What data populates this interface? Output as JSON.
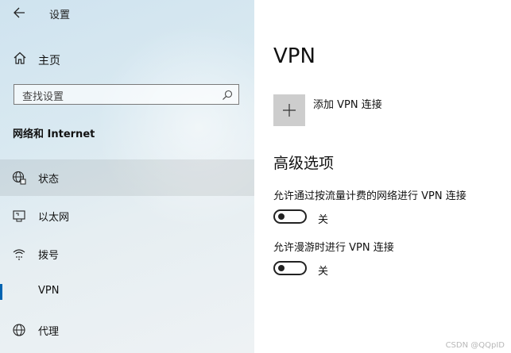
{
  "header": {
    "title": "设置"
  },
  "sidebar": {
    "home_label": "主页",
    "search_placeholder": "查找设置",
    "section_title": "网络和 Internet",
    "items": [
      {
        "label": "状态",
        "icon": "globe-status-icon",
        "selected": true
      },
      {
        "label": "以太网",
        "icon": "ethernet-icon",
        "selected": false
      },
      {
        "label": "拨号",
        "icon": "dialup-icon",
        "selected": false
      },
      {
        "label": "VPN",
        "icon": "vpn-icon",
        "selected": false,
        "active_indicator": true
      },
      {
        "label": "代理",
        "icon": "globe-icon",
        "selected": false
      }
    ]
  },
  "main": {
    "title": "VPN",
    "add_label": "添加 VPN 连接",
    "advanced_title": "高级选项",
    "options": [
      {
        "label": "允许通过按流量计费的网络进行 VPN 连接",
        "state": "关"
      },
      {
        "label": "允许漫游时进行 VPN 连接",
        "state": "关"
      }
    ]
  },
  "watermark": "CSDN @QQpID",
  "colors": {
    "accent": "#0063b1",
    "tile": "#cdcdcd"
  }
}
